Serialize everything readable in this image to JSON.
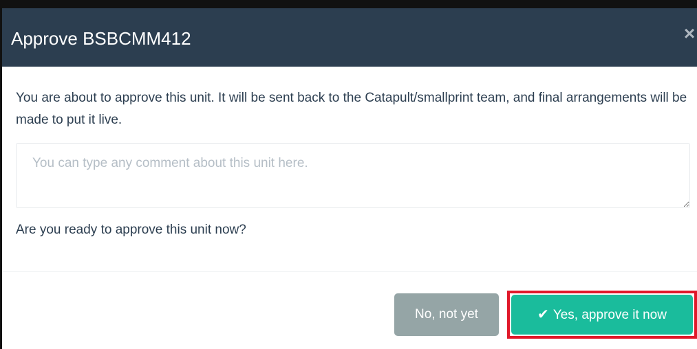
{
  "modal": {
    "title": "Approve BSBCMM412",
    "close_symbol": "×",
    "body_text": "You are about to approve this unit. It will be sent back to the Catapult/smallprint team, and final arrangements will be made to put it live.",
    "comment_placeholder": "You can type any comment about this unit here.",
    "comment_value": "",
    "question": "Are you ready to approve this unit now?"
  },
  "buttons": {
    "no_label": "No, not yet",
    "yes_label": "Yes, approve it now",
    "yes_icon": "check-icon",
    "yes_icon_glyph": "✔"
  },
  "colors": {
    "header_bg": "#2c3e50",
    "no_button_bg": "#95a5a6",
    "yes_button_bg": "#1abc9c",
    "highlight_border": "#e0192a"
  }
}
